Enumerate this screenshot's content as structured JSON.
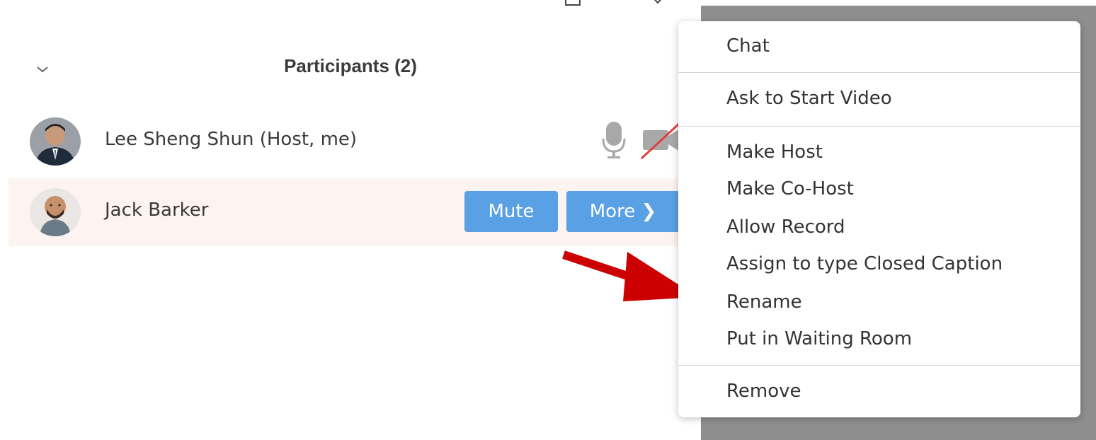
{
  "panel": {
    "title": "Participants (2)"
  },
  "participants": [
    {
      "name": "Lee Sheng Shun (Host, me)",
      "mic": "mic-icon",
      "video": "video-off-icon"
    },
    {
      "name": "Jack Barker",
      "mute_label": "Mute",
      "more_label": "More ❯"
    }
  ],
  "context_menu": {
    "items": [
      "Chat",
      "Ask to Start Video",
      "Make Host",
      "Make Co-Host",
      "Allow Record",
      "Assign to type Closed Caption",
      "Rename",
      "Put in Waiting Room",
      "Remove"
    ]
  },
  "colors": {
    "button_blue": "#5aa0e4",
    "row_hover": "#fdf3f1",
    "annotation_arrow": "#cc0000",
    "backdrop_gray": "#8e8e8e"
  }
}
